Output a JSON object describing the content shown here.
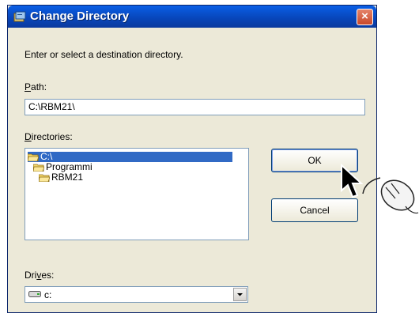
{
  "dialog": {
    "title": "Change Directory",
    "close_label": "×",
    "instruction": "Enter or select a destination directory.",
    "path_label_mnemonic": "P",
    "path_label_rest": "ath:",
    "path_value": "C:\\RBM21\\",
    "dirs_label_mnemonic": "D",
    "dirs_label_rest": "irectories:",
    "directories": [
      "C:\\",
      "Programmi",
      "RBM21"
    ],
    "selected_directory": "C:\\",
    "drives_label_pre": "Dri",
    "drives_label_mnemonic": "v",
    "drives_label_post": "es:",
    "drive_value": "c:",
    "ok_label": "OK",
    "cancel_label": "Cancel"
  },
  "colors": {
    "titlebar": "#0845b8",
    "dialog_bg": "#ece9d8",
    "selection": "#316ac5",
    "close_button": "#c8482a"
  },
  "icons": {
    "title": "app-icon",
    "folder": "folder-icon",
    "drive": "drive-icon",
    "dropdown": "chevron-down-icon",
    "pointer": "mouse-pointer-icon",
    "mouse": "computer-mouse-icon"
  }
}
